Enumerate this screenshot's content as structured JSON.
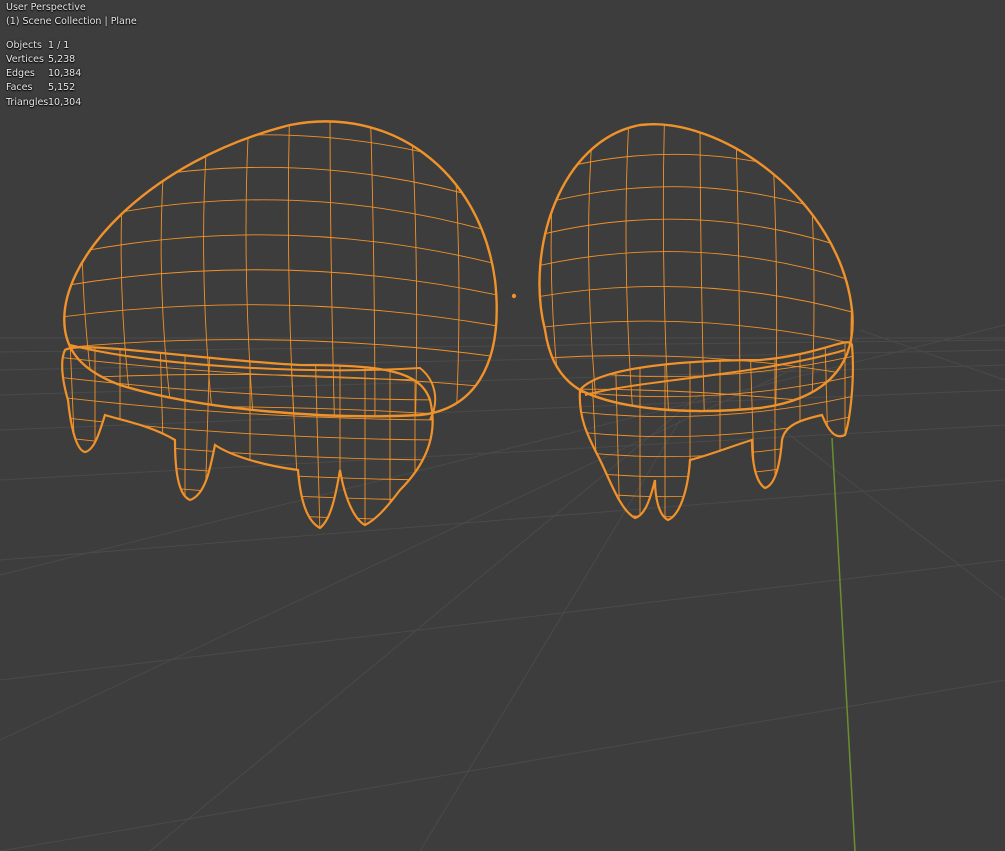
{
  "viewport": {
    "view_name": "User Perspective",
    "context": "(1) Scene Collection | Plane",
    "stats": [
      {
        "label": "Objects",
        "value": "1 / 1"
      },
      {
        "label": "Vertices",
        "value": "5,238"
      },
      {
        "label": "Edges",
        "value": "10,384"
      },
      {
        "label": "Faces",
        "value": "5,152"
      },
      {
        "label": "Triangles",
        "value": "10,304"
      }
    ],
    "colors": {
      "background": "#3d3d3d",
      "grid": "#4a4a4a",
      "wireframe": "#f0922a",
      "y_axis": "#6a8f2e",
      "origin": "#f0922a"
    },
    "display_mode": "wireframe",
    "selected_object": "Plane"
  }
}
